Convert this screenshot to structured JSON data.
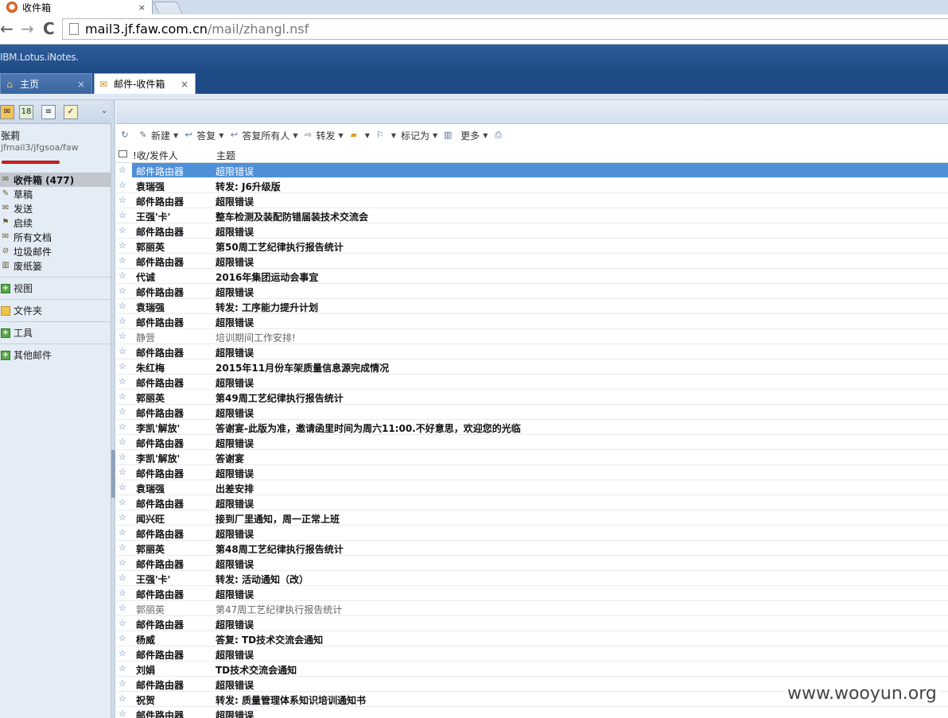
{
  "browser": {
    "tab_title": "收件箱",
    "tab_close": "×",
    "url_host": "mail3.jf.faw.com.cn",
    "url_path": "/mail/zhangl.nsf",
    "back": "←",
    "forward": "→",
    "reload": "C"
  },
  "app": {
    "brand": "IBM.Lotus.iNotes.",
    "tabs": [
      {
        "label": "主页",
        "close": "×"
      },
      {
        "label": "邮件-收件箱",
        "close": "×"
      }
    ]
  },
  "user": {
    "name": "张莉",
    "path": "jfmail3/jfgsoa/faw"
  },
  "folders": [
    {
      "label": "收件箱 (477)",
      "icon": "inbox-icon"
    },
    {
      "label": "草稿",
      "icon": "drafts-icon"
    },
    {
      "label": "发送",
      "icon": "sent-icon"
    },
    {
      "label": "启续",
      "icon": "follow-up-icon"
    },
    {
      "label": "所有文档",
      "icon": "all-docs-icon"
    },
    {
      "label": "垃圾邮件",
      "icon": "junk-icon"
    },
    {
      "label": "废纸篓",
      "icon": "trash-icon"
    }
  ],
  "sections": [
    {
      "label": "视图"
    },
    {
      "label": "文件夹"
    },
    {
      "label": "工具"
    },
    {
      "label": "其他邮件"
    }
  ],
  "toolbar": {
    "new": "新建",
    "reply": "答复",
    "reply_all": "答复所有人",
    "forward": "转发",
    "mark_as": "标记为",
    "more": "更多"
  },
  "columns": {
    "from": "!收/发件人",
    "subject": "主题"
  },
  "messages": [
    {
      "from": "邮件路由器",
      "subject": "超限错误",
      "state": "sel"
    },
    {
      "from": "袁瑞强",
      "subject": "转发: J6升级版",
      "state": "unread"
    },
    {
      "from": "邮件路由器",
      "subject": "超限错误",
      "state": "unread"
    },
    {
      "from": "王强'卡'",
      "subject": "整车检测及装配防错届装技术交流会",
      "state": "unread"
    },
    {
      "from": "邮件路由器",
      "subject": "超限错误",
      "state": "unread"
    },
    {
      "from": "郭丽英",
      "subject": "第50周工艺纪律执行报告统计",
      "state": "unread"
    },
    {
      "from": "邮件路由器",
      "subject": "超限错误",
      "state": "unread"
    },
    {
      "from": "代诚",
      "subject": "2016年集团运动会事宜",
      "state": "unread"
    },
    {
      "from": "邮件路由器",
      "subject": "超限错误",
      "state": "unread"
    },
    {
      "from": "袁瑞强",
      "subject": "转发: 工序能力提升计划",
      "state": "unread"
    },
    {
      "from": "邮件路由器",
      "subject": "超限错误",
      "state": "unread"
    },
    {
      "from": "静营",
      "subject": "培训期间工作安排!",
      "state": "read"
    },
    {
      "from": "邮件路由器",
      "subject": "超限错误",
      "state": "unread"
    },
    {
      "from": "朱红梅",
      "subject": "2015年11月份车架质量信息源完成情况",
      "state": "unread"
    },
    {
      "from": "邮件路由器",
      "subject": "超限错误",
      "state": "unread"
    },
    {
      "from": "郭丽英",
      "subject": "第49周工艺纪律执行报告统计",
      "state": "unread"
    },
    {
      "from": "邮件路由器",
      "subject": "超限错误",
      "state": "unread"
    },
    {
      "from": "李凯'解放'",
      "subject": "答谢宴-此版为准，邀请函里时间为周六11:00.不好意思，欢迎您的光临",
      "state": "unread"
    },
    {
      "from": "邮件路由器",
      "subject": "超限错误",
      "state": "unread"
    },
    {
      "from": "李凯'解放'",
      "subject": "答谢宴",
      "state": "unread"
    },
    {
      "from": "邮件路由器",
      "subject": "超限错误",
      "state": "unread"
    },
    {
      "from": "袁瑞强",
      "subject": "出差安排",
      "state": "unread"
    },
    {
      "from": "邮件路由器",
      "subject": "超限错误",
      "state": "unread"
    },
    {
      "from": "闻兴旺",
      "subject": "接到厂里通知，周一正常上班",
      "state": "unread"
    },
    {
      "from": "邮件路由器",
      "subject": "超限错误",
      "state": "unread"
    },
    {
      "from": "郭丽英",
      "subject": "第48周工艺纪律执行报告统计",
      "state": "unread"
    },
    {
      "from": "邮件路由器",
      "subject": "超限错误",
      "state": "unread"
    },
    {
      "from": "王强'卡'",
      "subject": "转发: 活动通知（改）",
      "state": "unread"
    },
    {
      "from": "邮件路由器",
      "subject": "超限错误",
      "state": "unread"
    },
    {
      "from": "郭丽英",
      "subject": "第47周工艺纪律执行报告统计",
      "state": "read"
    },
    {
      "from": "邮件路由器",
      "subject": "超限错误",
      "state": "unread"
    },
    {
      "from": "杨威",
      "subject": "答复: TD技术交流会通知",
      "state": "unread"
    },
    {
      "from": "邮件路由器",
      "subject": "超限错误",
      "state": "unread"
    },
    {
      "from": "刘娟",
      "subject": "TD技术交流会通知",
      "state": "unread"
    },
    {
      "from": "邮件路由器",
      "subject": "超限错误",
      "state": "unread"
    },
    {
      "from": "祝贺",
      "subject": "转发: 质量管理体系知识培训通知书",
      "state": "unread"
    },
    {
      "from": "邮件路由器",
      "subject": "超限错误",
      "state": "unread"
    }
  ],
  "watermark": "www.wooyun.org",
  "colors": {
    "selected_row": "#4f8fd8",
    "app_header": "#1e4a85",
    "star": "#3e72b8"
  }
}
